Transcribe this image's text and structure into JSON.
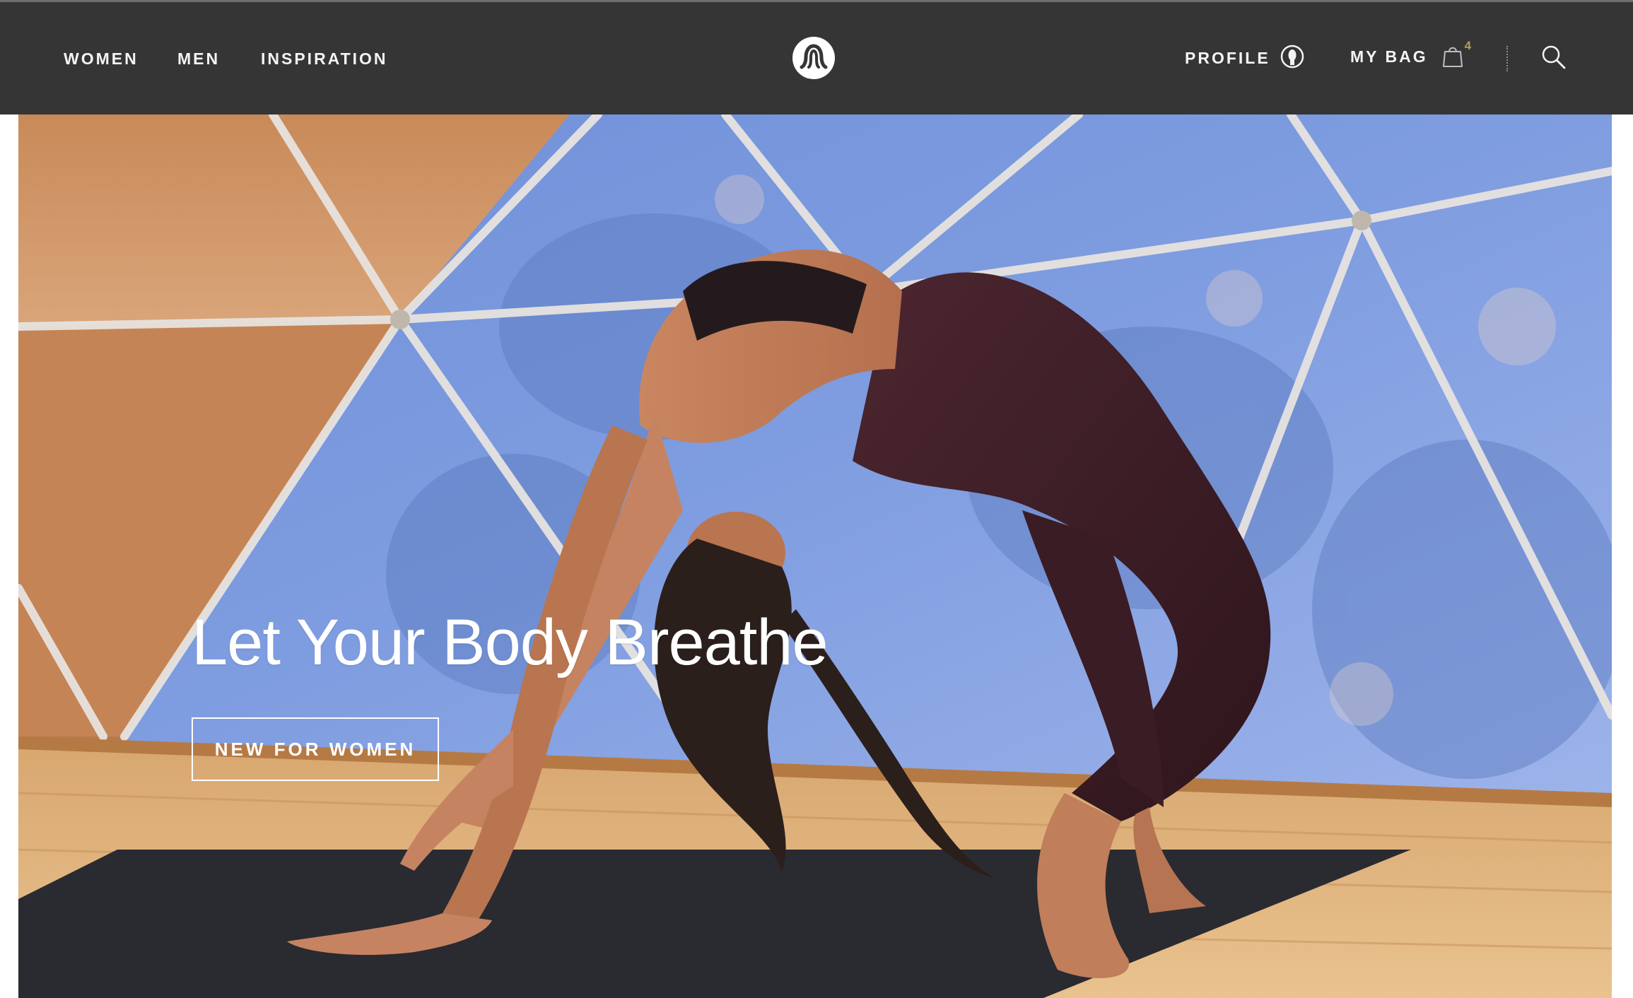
{
  "nav": {
    "women": "WOMEN",
    "men": "MEN",
    "inspiration": "INSPIRATION"
  },
  "header": {
    "logo_icon": "lululemon-logo-icon",
    "profile_label": "PROFILE",
    "profile_icon": "profile-icon",
    "bag_label": "MY BAG",
    "bag_icon": "shopping-bag-icon",
    "bag_count": "4",
    "search_icon": "search-icon"
  },
  "hero": {
    "headline": "Let Your Body Breathe",
    "cta_label": "NEW FOR WOMEN",
    "image": "yoga-backbend-photo"
  },
  "colors": {
    "topbar_bg": "#353535",
    "nav_text": "#f4f4f4",
    "bag_count": "#b39c5a",
    "hero_text": "#ffffff"
  }
}
